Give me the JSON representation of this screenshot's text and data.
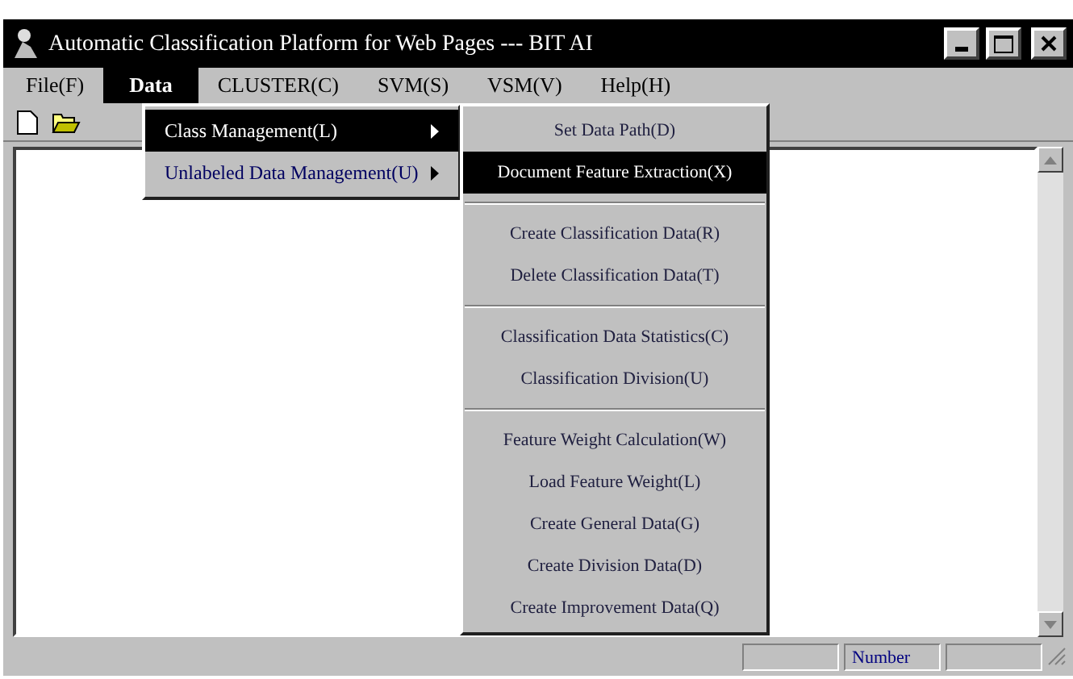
{
  "window": {
    "title": "Automatic Classification Platform for Web Pages --- BIT AI"
  },
  "menu_bar": [
    {
      "label": "File(F)",
      "selected": false
    },
    {
      "label": "Data",
      "selected": true
    },
    {
      "label": "CLUSTER(C)",
      "selected": false
    },
    {
      "label": "SVM(S)",
      "selected": false
    },
    {
      "label": "VSM(V)",
      "selected": false
    },
    {
      "label": "Help(H)",
      "selected": false
    }
  ],
  "data_menu": [
    {
      "label": "Class Management(L)",
      "selected": true,
      "has_submenu": true
    },
    {
      "label": "Unlabeled Data Management(U)",
      "selected": false,
      "has_submenu": true
    }
  ],
  "class_submenu": [
    {
      "kind": "item",
      "label": "Set Data Path(D)",
      "selected": false
    },
    {
      "kind": "item",
      "label": "Document Feature Extraction(X)",
      "selected": true
    },
    {
      "kind": "separator"
    },
    {
      "kind": "item",
      "label": "Create Classification Data(R)",
      "selected": false
    },
    {
      "kind": "item",
      "label": "Delete Classification Data(T)",
      "selected": false
    },
    {
      "kind": "separator"
    },
    {
      "kind": "item",
      "label": "Classification Data Statistics(C)",
      "selected": false
    },
    {
      "kind": "item",
      "label": "Classification Division(U)",
      "selected": false
    },
    {
      "kind": "separator"
    },
    {
      "kind": "item",
      "label": "Feature Weight Calculation(W)",
      "selected": false
    },
    {
      "kind": "item",
      "label": "Load Feature Weight(L)",
      "selected": false
    },
    {
      "kind": "item",
      "label": "Create General Data(G)",
      "selected": false
    },
    {
      "kind": "item",
      "label": "Create Division Data(D)",
      "selected": false
    },
    {
      "kind": "item",
      "label": "Create Improvement Data(Q)",
      "selected": false
    }
  ],
  "status_bar": {
    "indicator": "Number"
  }
}
